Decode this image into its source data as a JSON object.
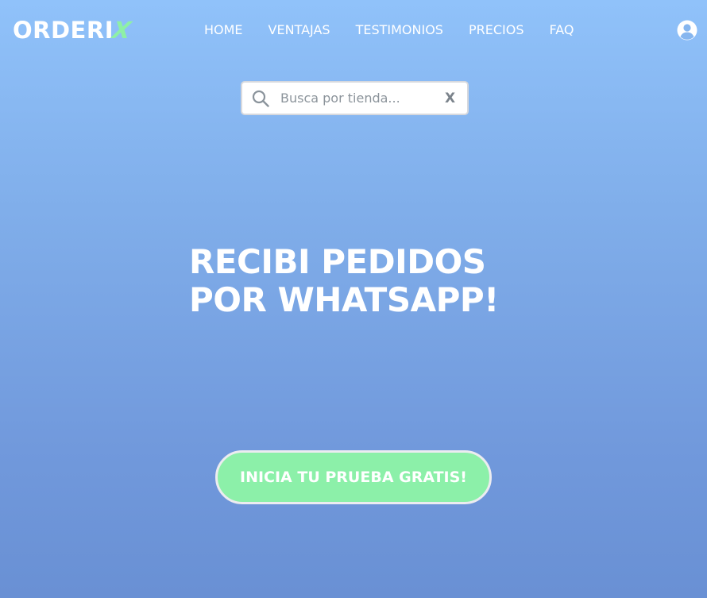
{
  "header": {
    "logo_main": "ORDERI",
    "logo_accent": "X",
    "nav": [
      {
        "label": "HOME"
      },
      {
        "label": "VENTAJAS"
      },
      {
        "label": "TESTIMONIOS"
      },
      {
        "label": "PRECIOS"
      },
      {
        "label": "FAQ"
      }
    ],
    "user_icon": "user-circle-icon"
  },
  "search": {
    "placeholder": "Busca por tienda...",
    "value": "",
    "icon": "search-icon",
    "clear_label": "X"
  },
  "hero": {
    "title_line1": "RECIBI PEDIDOS",
    "title_line2": "POR WHATSAPP!",
    "cta_label": "INICIA TU PRUEBA GRATIS!"
  },
  "colors": {
    "background_top": "#90c2fa",
    "background_bottom": "#6990d4",
    "accent_green": "#8ef0a6",
    "text": "#ffffff"
  }
}
